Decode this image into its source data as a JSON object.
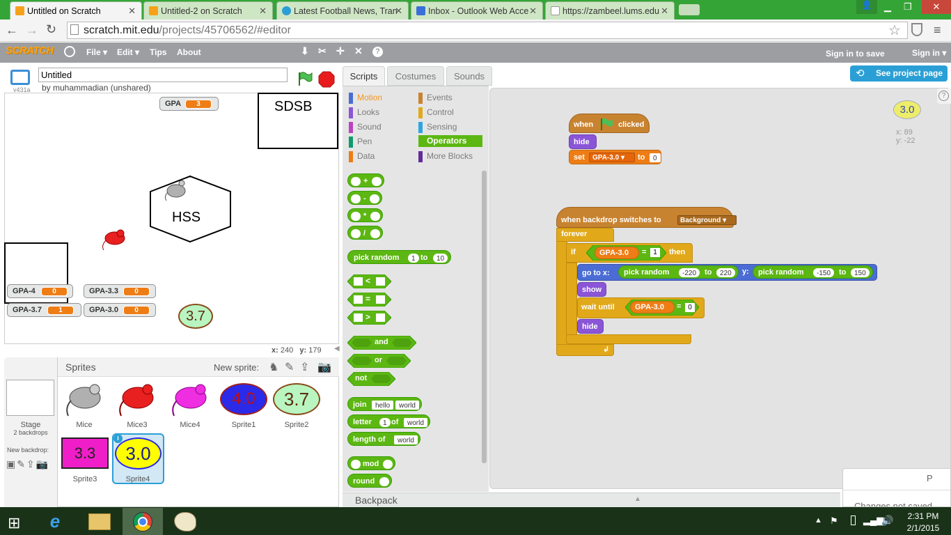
{
  "browser": {
    "tabs": [
      {
        "title": "Untitled on Scratch",
        "active": true
      },
      {
        "title": "Untitled-2 on Scratch",
        "active": false
      },
      {
        "title": "Latest Football News, Tran",
        "active": false
      },
      {
        "title": "Inbox - Outlook Web Acce",
        "active": false
      },
      {
        "title": "https://zambeel.lums.edu",
        "active": false
      }
    ],
    "url_host": "scratch.mit.edu",
    "url_path": "/projects/45706562/#editor"
  },
  "menu": {
    "logo": "SCRATCH",
    "items": [
      "File ▾",
      "Edit ▾",
      "Tips",
      "About"
    ],
    "sign_in_save": "Sign in to save",
    "sign_in": "Sign in ▾"
  },
  "project": {
    "title_value": "Untitled",
    "author": "by muhammadian (unshared)",
    "version": "v431a"
  },
  "stage": {
    "vars": [
      {
        "label": "GPA",
        "value": "3"
      },
      {
        "label": "GPA-4",
        "value": "0"
      },
      {
        "label": "GPA-3.3",
        "value": "0"
      },
      {
        "label": "GPA-3.7",
        "value": "1"
      },
      {
        "label": "GPA-3.0",
        "value": "0"
      }
    ],
    "sdsb": "SDSB",
    "hss": "HSS",
    "badge": "3.7",
    "coords": {
      "x_label": "x:",
      "x": "240",
      "y_label": "y:",
      "y": "179"
    }
  },
  "editor_tabs": [
    "Scripts",
    "Costumes",
    "Sounds"
  ],
  "see_project": "See project page",
  "categories": [
    {
      "name": "Motion",
      "color": "#4a6cd4"
    },
    {
      "name": "Events",
      "color": "#c88330"
    },
    {
      "name": "Looks",
      "color": "#8a55d7"
    },
    {
      "name": "Control",
      "color": "#e1a91a"
    },
    {
      "name": "Sound",
      "color": "#bb42c3"
    },
    {
      "name": "Sensing",
      "color": "#2ca5e2"
    },
    {
      "name": "Pen",
      "color": "#0e9a6c"
    },
    {
      "name": "Operators",
      "color": "#5cb712"
    },
    {
      "name": "Data",
      "color": "#ee7d16"
    },
    {
      "name": "More Blocks",
      "color": "#632d99"
    }
  ],
  "palette": {
    "plus": "+",
    "minus": "-",
    "times": "*",
    "div": "/",
    "pick_random": "pick random",
    "to": "to",
    "r1": "1",
    "r2": "10",
    "lt": "<",
    "eq": "=",
    "gt": ">",
    "and": "and",
    "or": "or",
    "not": "not",
    "join": "join",
    "hello": "hello",
    "world": "world",
    "letter": "letter",
    "one": "1",
    "of": "of",
    "length_of": "length of",
    "mod": "mod",
    "round": "round"
  },
  "scripts": {
    "when": "when",
    "clicked": "clicked",
    "hide": "hide",
    "set": "set",
    "var": "GPA-3.0",
    "to": "to",
    "zero": "0",
    "when_backdrop": "when backdrop switches to",
    "backdrop": "Background",
    "forever": "forever",
    "if": "if",
    "one": "1",
    "then": "then",
    "goto": "go to x:",
    "pick_random": "pick random",
    "xmin": "-220",
    "xmax": "220",
    "y": "y:",
    "ymin": "-150",
    "ymax": "150",
    "show": "show",
    "wait_until": "wait until",
    "sprite_badge": "3.0",
    "sx": "x: 89",
    "sy": "y: -22"
  },
  "sprites_panel": {
    "title": "Sprites",
    "new_sprite": "New sprite:",
    "stage_label": "Stage",
    "backdrops": "2 backdrops",
    "new_backdrop": "New backdrop:",
    "sprites": [
      {
        "name": "Mice"
      },
      {
        "name": "Mice3"
      },
      {
        "name": "Mice4"
      },
      {
        "name": "Sprite1",
        "text": "4.0"
      },
      {
        "name": "Sprite2",
        "text": "3.7"
      },
      {
        "name": "Sprite3",
        "text": "3.3"
      },
      {
        "name": "Sprite4",
        "text": "3.0"
      }
    ]
  },
  "backpack": "Backpack",
  "changes_not_saved": "Changes not saved",
  "tray": {
    "time": "2:31 PM",
    "date": "2/1/2015"
  }
}
